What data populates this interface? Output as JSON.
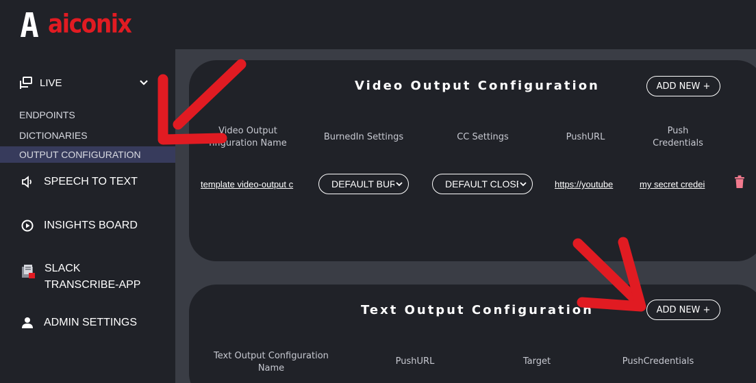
{
  "app": {
    "logo_text": "aiconix"
  },
  "sidebar": {
    "live": {
      "label": "LIVE",
      "icon": "live-broadcast-icon",
      "expanded": true
    },
    "sub_items": [
      {
        "label": "ENDPOINTS",
        "active": false
      },
      {
        "label": "DICTIONARIES",
        "active": false
      },
      {
        "label": "OUTPUT CONFIGURATION",
        "active": true
      }
    ],
    "items": [
      {
        "label": "SPEECH TO TEXT",
        "icon": "speaker-icon"
      },
      {
        "label": "INSIGHTS BOARD",
        "icon": "play-circle-icon"
      },
      {
        "label_line1": "SLACK",
        "label_line2": "TRANSCRIBE-APP",
        "icon": "slack-app-icon"
      },
      {
        "label": "ADMIN SETTINGS",
        "icon": "user-icon"
      }
    ]
  },
  "video_config": {
    "title": "Video Output Configuration",
    "add_label": "ADD NEW +",
    "columns": [
      {
        "line1": "Video Output",
        "line2": "nfiguration Name"
      },
      {
        "line1": "BurnedIn Settings"
      },
      {
        "line1": "CC Settings"
      },
      {
        "line1": "PushURL"
      },
      {
        "line1": "Push",
        "line2": "Credentials"
      }
    ],
    "rows": [
      {
        "name": "template video-output c",
        "burnedin": "DEFAULT BURI",
        "cc": "DEFAULT CLOSE",
        "push_url": "https://youtube",
        "credentials": "my secret credei"
      }
    ]
  },
  "text_config": {
    "title": "Text Output Configuration",
    "add_label": "ADD NEW +",
    "columns": [
      {
        "line1": "Text Output Configuration",
        "line2": "Name"
      },
      {
        "line1": "PushURL"
      },
      {
        "line1": "Target"
      },
      {
        "line1": "PushCredentials"
      }
    ]
  },
  "colors": {
    "accent_red": "#e11b22",
    "panel": "#202228",
    "background": "#3a3d45",
    "active_item": "#373b5c",
    "trash": "#f27a8e"
  }
}
